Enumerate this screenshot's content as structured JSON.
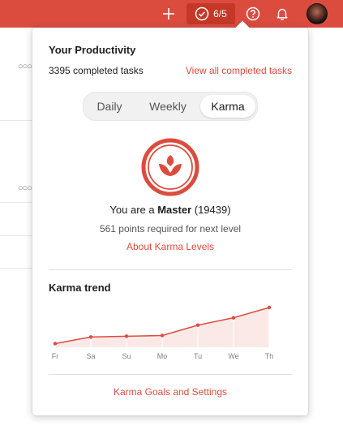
{
  "colors": {
    "brand": "#db4c3f",
    "topbar": "#db4c3f",
    "productivity_button": "#c53727",
    "text": "#202020",
    "muted": "#555555"
  },
  "topbar": {
    "productivity_count": "6/5",
    "icons": [
      "plus-icon",
      "check-circle-icon",
      "help-icon",
      "bell-icon",
      "avatar"
    ]
  },
  "popover": {
    "title": "Your Productivity",
    "completed_tasks": "3395 completed tasks",
    "view_all_link": "View all completed tasks",
    "tabs": [
      {
        "label": "Daily",
        "active": false
      },
      {
        "label": "Weekly",
        "active": false
      },
      {
        "label": "Karma",
        "active": true
      }
    ],
    "karma": {
      "level_prefix": "You are a ",
      "level_name": "Master",
      "points": " (19439)",
      "next_level": "561 points required for next level",
      "about_link": "About Karma Levels"
    },
    "trend_title": "Karma trend",
    "footer_link": "Karma Goals and Settings"
  },
  "chart_data": {
    "type": "area",
    "title": "Karma trend",
    "categories": [
      "Fr",
      "Sa",
      "Su",
      "Mo",
      "Tu",
      "We",
      "Th"
    ],
    "values": [
      18950,
      19040,
      19050,
      19060,
      19200,
      19300,
      19439
    ],
    "ylim": [
      18900,
      19450
    ],
    "grid": false
  }
}
